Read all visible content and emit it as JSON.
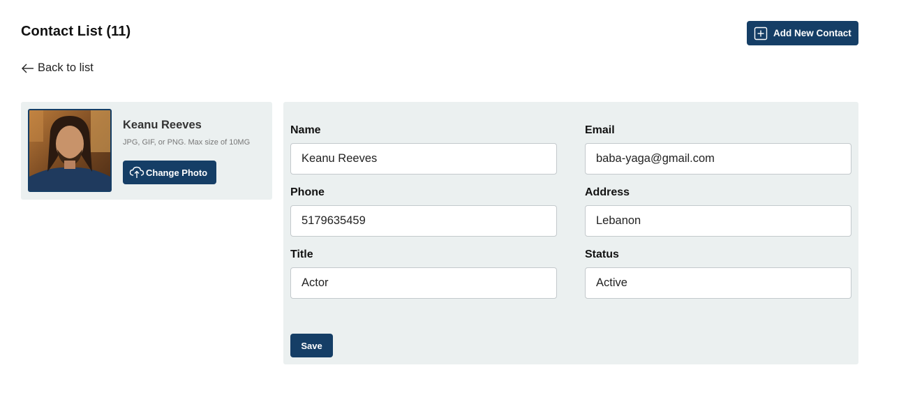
{
  "header": {
    "title": "Contact List (11)",
    "add_button_label": "Add New Contact",
    "add_icon": "plus-square-icon"
  },
  "nav": {
    "back_label": "Back to list",
    "back_icon": "arrow-left-icon"
  },
  "profile": {
    "name": "Keanu Reeves",
    "photo_hint": "JPG, GIF, or PNG. Max size of 10MG",
    "change_photo_label": "Change Photo",
    "upload_icon": "cloud-upload-icon"
  },
  "form": {
    "name_label": "Name",
    "name_value": "Keanu Reeves",
    "email_label": "Email",
    "email_value": "baba-yaga@gmail.com",
    "phone_label": "Phone",
    "phone_value": "5179635459",
    "address_label": "Address",
    "address_value": "Lebanon",
    "title_label": "Title",
    "title_value": "Actor",
    "status_label": "Status",
    "status_value": "Active",
    "save_label": "Save"
  },
  "colors": {
    "primary": "#153e66",
    "panel_background": "#ebf0f0",
    "input_border": "#c3c9cc"
  }
}
